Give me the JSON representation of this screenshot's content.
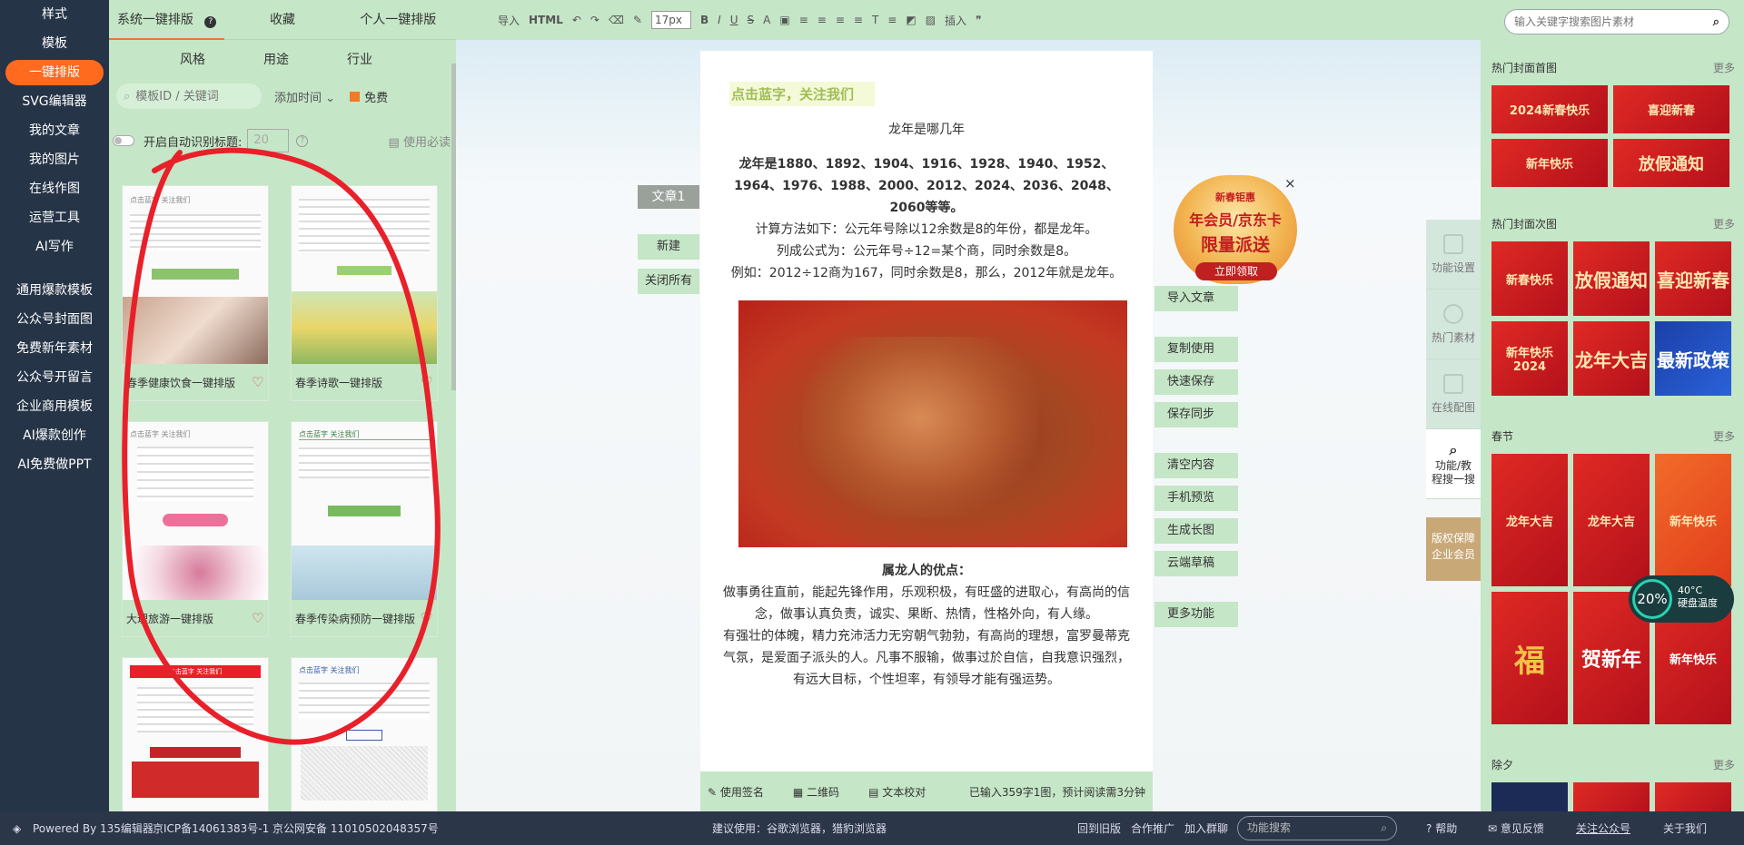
{
  "nav": {
    "items": [
      "样式",
      "模板",
      "一键排版",
      "SVG编辑器",
      "我的文章",
      "我的图片",
      "在线作图",
      "运营工具",
      "AI写作"
    ],
    "items2": [
      "通用爆款模板",
      "公众号封面图",
      "免费新年素材",
      "公众号开留言",
      "企业商用模板",
      "AI爆款创作",
      "AI免费做PPT"
    ],
    "active_index": 2
  },
  "templates": {
    "tabs": [
      "系统一键排版",
      "收藏",
      "个人一键排版"
    ],
    "subtabs": [
      "风格",
      "用途",
      "行业"
    ],
    "search_placeholder": "模板ID / 关键词",
    "sort": "添加时间",
    "free": "免费",
    "auto_label": "开启自动识别标题:",
    "auto_value": "20",
    "must_use": "使用必读",
    "cards": [
      {
        "title": "春季健康饮食一键排版",
        "head": "点击蓝字 关注我们"
      },
      {
        "title": "春季诗歌一键排版",
        "head": "点击蓝字 关注我们"
      },
      {
        "title": "大理旅游一键排版",
        "head": "点击蓝字 关注我们"
      },
      {
        "title": "春季传染病预防一键排版",
        "head": "点击蓝字 关注我们"
      },
      {
        "title": "",
        "head": "点击蓝字 关注我们"
      },
      {
        "title": "",
        "head": "点击蓝字 关注我们"
      }
    ]
  },
  "toolbar": {
    "items": [
      "导入",
      "HTML",
      "↶",
      "↷",
      "⌫",
      "✎",
      "B",
      "I",
      "U",
      "S",
      "A",
      "▣",
      "≡",
      "≡",
      "≡",
      "≡",
      "T",
      "≡",
      "◩",
      "▨",
      "插入",
      "❞"
    ],
    "font_size": "17px"
  },
  "editor": {
    "article_tab": "文章1",
    "left_buttons": [
      "新建",
      "关闭所有"
    ],
    "doc_header": "点击蓝字，关注我们",
    "title": "龙年是哪几年",
    "para_bold": "龙年是1880、1892、1904、1916、1928、1940、1952、1964、1976、1988、2000、2012、2024、2036、2048、2060等等。",
    "paras": [
      "计算方法如下：公元年号除以12余数是8的年份，都是龙年。",
      "列成公式为：公元年号÷12=某个商，同时余数是8。",
      "例如：2012÷12商为167，同时余数是8，那么，2012年就是龙年。"
    ],
    "sub_title": "属龙人的优点：",
    "paras2": [
      "做事勇往直前，能起先锋作用，乐观积极，有旺盛的进取心，有高尚的信念，做事认真负责，诚实、果断、热情，性格外向，有人缘。",
      "有强壮的体魄，精力充沛活力无穷朝气勃勃，有高尚的理想，富罗曼蒂克气氛，是爱面子派头的人。凡事不服输，做事过於自信，自我意识强烈，有远大目标，个性坦率，有领导才能有强运势。"
    ],
    "bottom": {
      "sign": "使用签名",
      "qr": "二维码",
      "check": "文本校对",
      "stat": "已输入359字1图，预计阅读需3分钟"
    },
    "side_buttons": [
      "导入文章",
      "复制使用",
      "快速保存",
      "保存同步",
      "清空内容",
      "手机预览",
      "生成长图",
      "云端草稿",
      "更多功能"
    ]
  },
  "promo": {
    "top": "新春钜惠",
    "line1": "年会员/京东卡",
    "line2": "限量派送",
    "button": "立即领取",
    "close": "×"
  },
  "right_tools": [
    "功能设置",
    "热门素材",
    "在线配图",
    "功能/教程搜一搜"
  ],
  "copyright_badge": [
    "版权保障",
    "企业会员"
  ],
  "materials": {
    "search_placeholder": "输入关键字搜索图片素材",
    "more": "更多",
    "sections": [
      "热门封面首图",
      "热门封面次图",
      "春节",
      "除夕"
    ],
    "cover1": [
      "2024新春快乐",
      "喜迎新春",
      "新年快乐",
      "放假通知"
    ],
    "cover2": [
      "新春快乐",
      "放假通知",
      "喜迎新春",
      "新年快乐2024",
      "龙年大吉",
      "最新政策"
    ],
    "spring": [
      "龙年大吉",
      "龙年大吉",
      "新年快乐",
      "福",
      "贺新年",
      "新年快乐"
    ]
  },
  "hw": {
    "percent": "20%",
    "temp": "40°C",
    "label": "硬盘温度"
  },
  "footer": {
    "powered": "Powered By 135编辑器",
    "icp": "京ICP备14061383号-1 京公网安备 11010502048357号",
    "advice": "建议使用：谷歌浏览器，猎豹浏览器",
    "old": "回到旧版",
    "coop": "合作推广",
    "group": "加入群聊",
    "search": "功能搜索",
    "help": "帮助",
    "feedback": "意见反馈",
    "follow": "关注公众号",
    "about": "关于我们"
  },
  "colors": {
    "accent": "#ff6a1f",
    "panel": "#c5e6c7",
    "nav": "#263447",
    "annotation": "#e8202a"
  }
}
